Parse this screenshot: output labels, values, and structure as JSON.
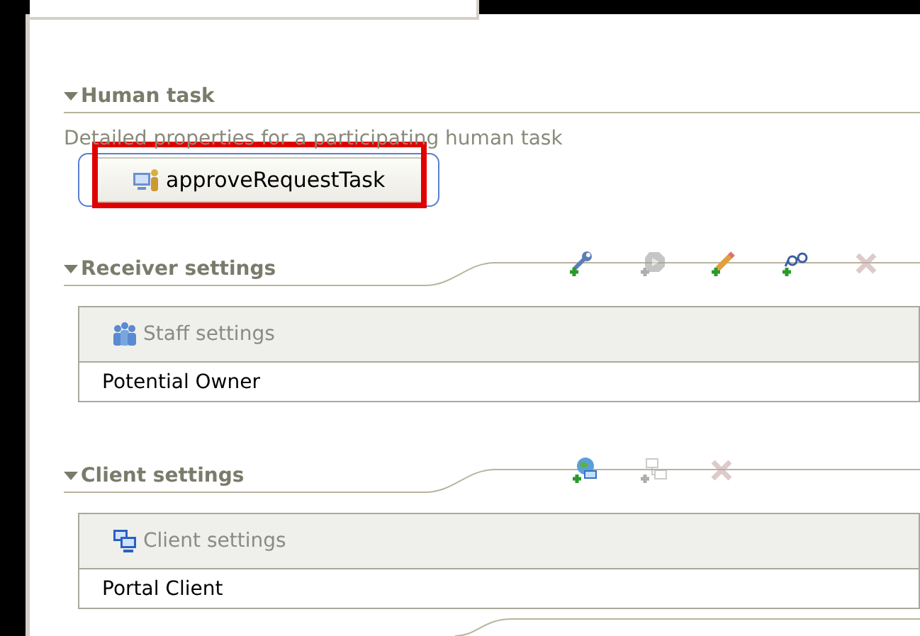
{
  "human_task": {
    "title": "Human task",
    "expanded": true,
    "description": "Detailed properties for a participating human task",
    "task_button": {
      "label": "approveRequestTask"
    }
  },
  "sections": [
    {
      "title": "Receiver settings",
      "expanded": true,
      "tools": [
        {
          "kind": "add-wrench",
          "disabled": false
        },
        {
          "kind": "add-stop",
          "disabled": true
        },
        {
          "kind": "add-pencil",
          "disabled": false
        },
        {
          "kind": "add-glasses",
          "disabled": false
        },
        {
          "kind": "delete",
          "disabled": true
        }
      ],
      "table": {
        "header": "Staff settings",
        "rows": [
          "Potential Owner"
        ]
      }
    },
    {
      "title": "Client settings",
      "expanded": true,
      "tools": [
        {
          "kind": "add-globe",
          "disabled": false
        },
        {
          "kind": "add-network",
          "disabled": true
        },
        {
          "kind": "delete",
          "disabled": true
        }
      ],
      "table": {
        "header": "Client settings",
        "rows": [
          "Portal Client"
        ]
      }
    }
  ]
}
